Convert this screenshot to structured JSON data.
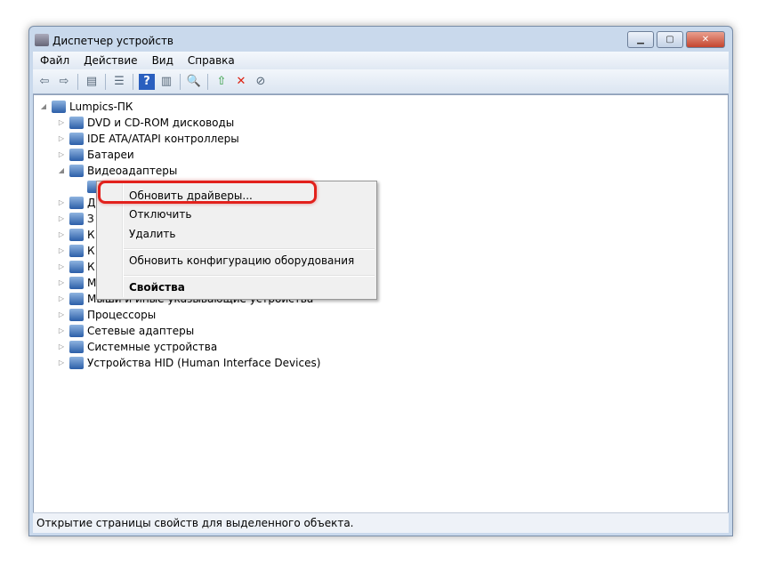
{
  "window": {
    "title": "Диспетчер устройств",
    "controls": [
      "minimize",
      "maximize",
      "close"
    ]
  },
  "menu": [
    "Файл",
    "Действие",
    "Вид",
    "Справка"
  ],
  "toolbar": [
    "back-icon",
    "forward-icon",
    "show-hide-console-tree-icon",
    "properties-icon",
    "help-icon",
    "show-action-pane-icon",
    "scan-hardware-icon",
    "update-driver-icon",
    "uninstall-icon",
    "disable-icon"
  ],
  "tree": {
    "root": "Lumpics-ПК",
    "items": [
      {
        "label": "DVD и CD-ROM дисководы",
        "state": "collapsed"
      },
      {
        "label": "IDE ATA/ATAPI контроллеры",
        "state": "collapsed"
      },
      {
        "label": "Батареи",
        "state": "collapsed"
      },
      {
        "label": "Видеоадаптеры",
        "state": "expanded"
      },
      {
        "label": "",
        "state": "child"
      },
      {
        "label": "Д",
        "state": "collapsed"
      },
      {
        "label": "З",
        "state": "collapsed"
      },
      {
        "label": "К",
        "state": "collapsed"
      },
      {
        "label": "К",
        "state": "collapsed"
      },
      {
        "label": "К",
        "state": "collapsed"
      },
      {
        "label": "М",
        "state": "collapsed"
      },
      {
        "label": "Мыши и иные указывающие устройства",
        "state": "collapsed"
      },
      {
        "label": "Процессоры",
        "state": "collapsed"
      },
      {
        "label": "Сетевые адаптеры",
        "state": "collapsed"
      },
      {
        "label": "Системные устройства",
        "state": "collapsed"
      },
      {
        "label": "Устройства HID (Human Interface Devices)",
        "state": "collapsed"
      }
    ]
  },
  "context_menu": {
    "items": [
      "Обновить драйверы...",
      "Отключить",
      "Удалить",
      "Обновить конфигурацию оборудования",
      "Свойства"
    ],
    "highlighted": "Обновить драйверы...",
    "highlight_color": "#e2211c"
  },
  "status": "Открытие страницы свойств для выделенного объекта."
}
